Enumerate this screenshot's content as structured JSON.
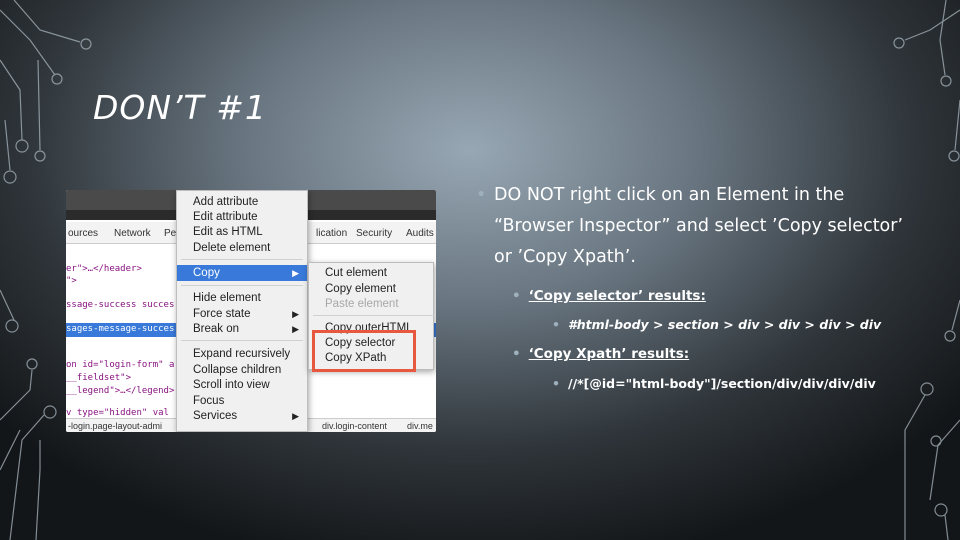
{
  "slide": {
    "title": "DON’T #1"
  },
  "screenshot": {
    "devtools_tabs": [
      "ources",
      "Network",
      "Pe",
      "lication",
      "Security",
      "Audits"
    ],
    "code_lines": [
      "er\">…</header>",
      "\">",
      "ssage-success succes",
      "sages-message-succes",
      "on id=\"login-form\" a",
      "__fieldset\">",
      "__legend\">…</legend>",
      "v  type=\"hidden\" val"
    ],
    "breadcrumbs": [
      "-login.page-layout-admi",
      "div.login-content",
      "div.me"
    ],
    "context_menu": {
      "items": [
        {
          "label": "Add attribute"
        },
        {
          "label": "Edit attribute"
        },
        {
          "label": "Edit as HTML"
        },
        {
          "label": "Delete element"
        },
        {
          "label": "Copy",
          "submenu": true,
          "highlighted": true
        },
        {
          "label": "Hide element"
        },
        {
          "label": "Force state",
          "submenu": true
        },
        {
          "label": "Break on",
          "submenu": true
        },
        {
          "label": "Expand recursively"
        },
        {
          "label": "Collapse children"
        },
        {
          "label": "Scroll into view"
        },
        {
          "label": "Focus"
        },
        {
          "label": "Services",
          "submenu": true
        }
      ],
      "arrow": "▶"
    },
    "copy_submenu": {
      "items": [
        {
          "label": "Cut element"
        },
        {
          "label": "Copy element"
        },
        {
          "label": "Paste element",
          "disabled": true
        },
        {
          "label": "Copy outerHTML"
        },
        {
          "label": "Copy selector"
        },
        {
          "label": "Copy XPath"
        }
      ]
    }
  },
  "bullets": {
    "main": "DO NOT right click on an Element in the “Browser Inspector” and select ’Copy selector’ or ’Copy Xpath’.",
    "sub1_label": "‘Copy selector’ results:",
    "sub1_value": "#html-body > section > div > div > div > div",
    "sub2_label": "‘Copy Xpath’ results:",
    "sub2_value": "//*[@id=\"html-body\"]/section/div/div/div/div",
    "dot": "•"
  },
  "colors": {
    "highlight": "#3879d9",
    "callout_box": "#e8583f"
  }
}
